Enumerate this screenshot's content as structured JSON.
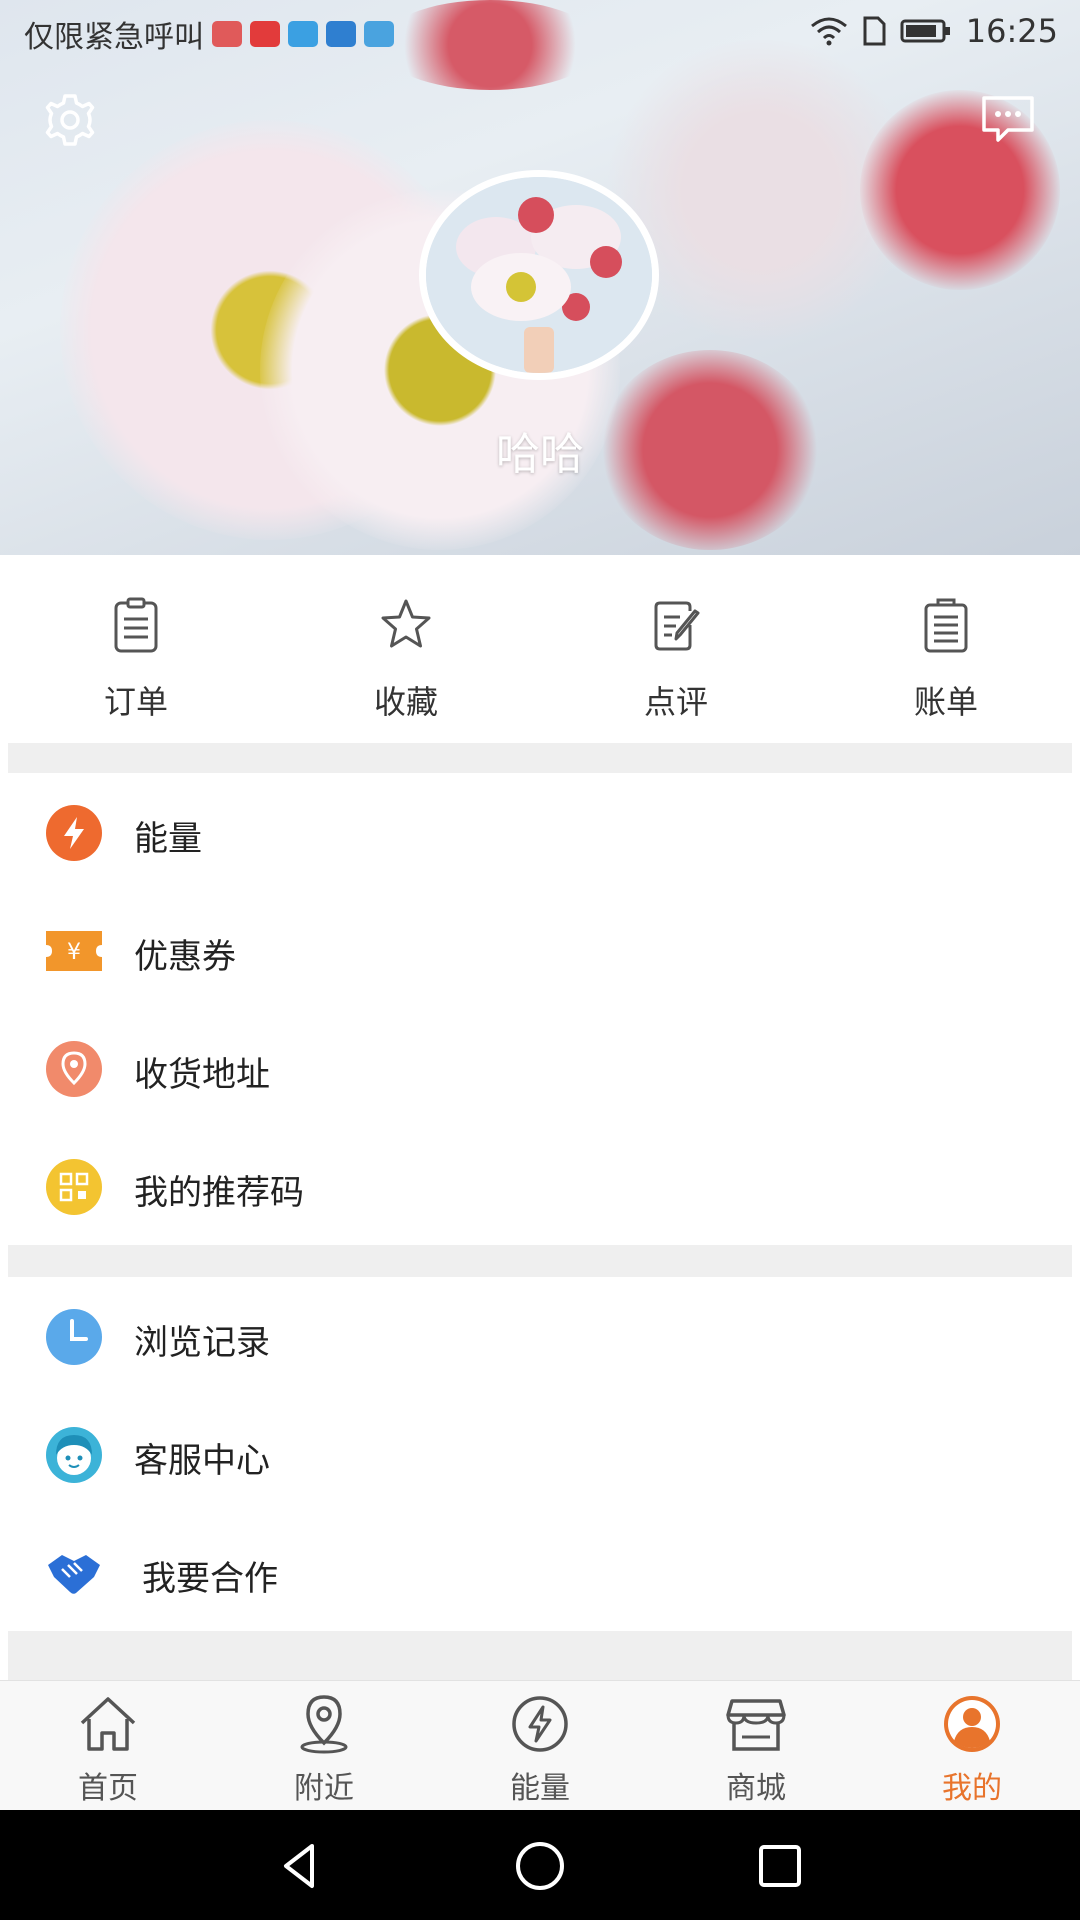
{
  "status_bar": {
    "carrier_text": "仅限紧急呼叫",
    "time": "16:25"
  },
  "profile": {
    "username": "哈哈"
  },
  "quick_actions": [
    {
      "label": "订单",
      "icon": "order-clipboard-icon"
    },
    {
      "label": "收藏",
      "icon": "star-icon"
    },
    {
      "label": "点评",
      "icon": "review-edit-icon"
    },
    {
      "label": "账单",
      "icon": "bill-clipboard-icon"
    }
  ],
  "menu_group_1": [
    {
      "label": "能量",
      "icon": "energy-bolt-icon"
    },
    {
      "label": "优惠券",
      "icon": "coupon-icon"
    },
    {
      "label": "收货地址",
      "icon": "location-pin-icon"
    },
    {
      "label": "我的推荐码",
      "icon": "referral-code-icon"
    }
  ],
  "menu_group_2": [
    {
      "label": "浏览记录",
      "icon": "clock-icon"
    },
    {
      "label": "客服中心",
      "icon": "customer-service-icon"
    },
    {
      "label": "我要合作",
      "icon": "handshake-icon"
    }
  ],
  "tab_bar": [
    {
      "label": "首页",
      "icon": "home-icon",
      "active": false
    },
    {
      "label": "附近",
      "icon": "nearby-pin-icon",
      "active": false
    },
    {
      "label": "能量",
      "icon": "energy-circle-icon",
      "active": false
    },
    {
      "label": "商城",
      "icon": "store-icon",
      "active": false
    },
    {
      "label": "我的",
      "icon": "profile-icon",
      "active": true
    }
  ],
  "colors": {
    "accent": "#e8742c",
    "energy": "#ee6a2f",
    "coupon": "#f2962b",
    "address": "#f18a6b",
    "referral": "#f3c431",
    "history": "#5aa9ea",
    "service": "#3cb3d8",
    "cooperate": "#2b6fd6"
  }
}
